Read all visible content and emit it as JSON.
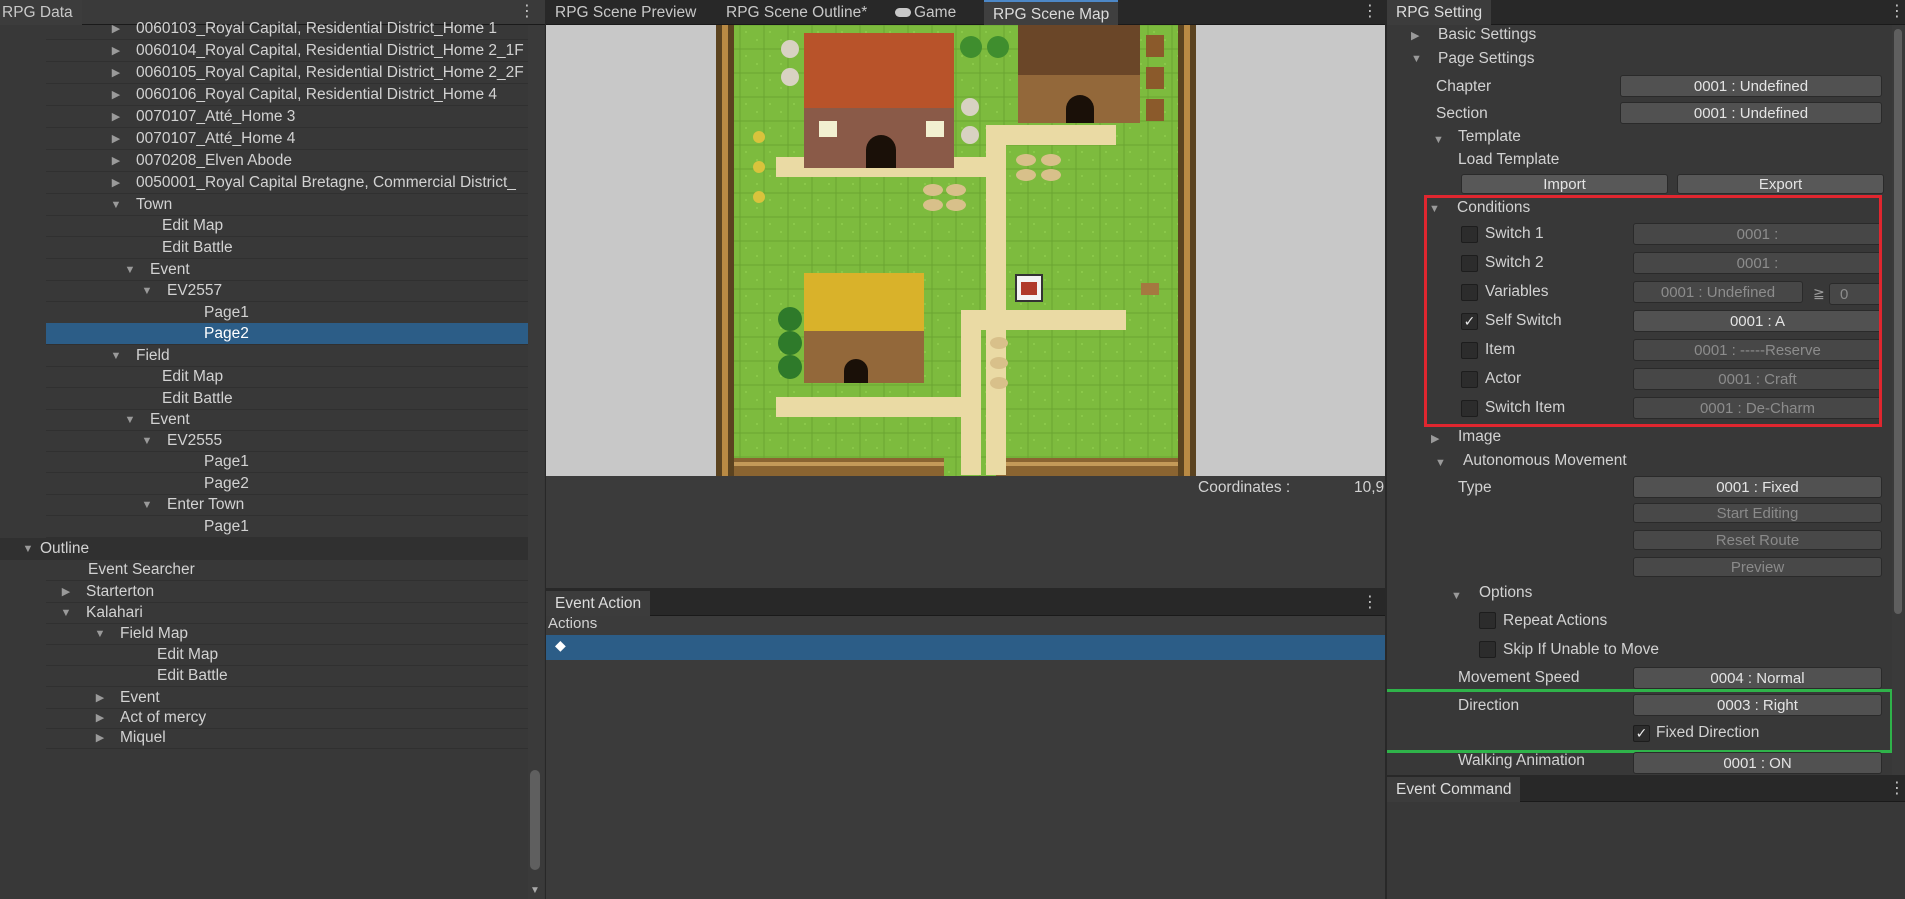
{
  "left": {
    "tab": "RPG Data",
    "rows": [
      {
        "label": "0060103_Royal Capital, Residential District_Home 1",
        "arrow": "right"
      },
      {
        "label": "0060104_Royal Capital, Residential District_Home 2_1F",
        "arrow": "right"
      },
      {
        "label": "0060105_Royal Capital, Residential District_Home 2_2F",
        "arrow": "right"
      },
      {
        "label": "0060106_Royal Capital, Residential District_Home 4",
        "arrow": "right"
      },
      {
        "label": "0070107_Atté_Home 3",
        "arrow": "right"
      },
      {
        "label": "0070107_Atté_Home 4",
        "arrow": "right"
      },
      {
        "label": "0070208_Elven Abode",
        "arrow": "right"
      },
      {
        "label": "0050001_Royal Capital Bretagne, Commercial District_",
        "arrow": "right"
      },
      {
        "label": "Town",
        "arrow": "down"
      },
      {
        "label": "Edit Map",
        "arrow": ""
      },
      {
        "label": "Edit Battle",
        "arrow": ""
      },
      {
        "label": "Event",
        "arrow": "down"
      },
      {
        "label": "EV2557",
        "arrow": "down"
      },
      {
        "label": "Page1",
        "arrow": ""
      },
      {
        "label": "Page2",
        "arrow": ""
      },
      {
        "label": "Field",
        "arrow": "down"
      },
      {
        "label": "Edit Map",
        "arrow": ""
      },
      {
        "label": "Edit Battle",
        "arrow": ""
      },
      {
        "label": "Event",
        "arrow": "down"
      },
      {
        "label": "EV2555",
        "arrow": "down"
      },
      {
        "label": "Page1",
        "arrow": ""
      },
      {
        "label": "Page2",
        "arrow": ""
      },
      {
        "label": "Enter Town",
        "arrow": "down"
      },
      {
        "label": "Page1",
        "arrow": ""
      },
      {
        "label": "Outline",
        "arrow": "down"
      },
      {
        "label": "Event Searcher",
        "arrow": ""
      },
      {
        "label": "Starterton",
        "arrow": "right"
      },
      {
        "label": "Kalahari",
        "arrow": "down"
      },
      {
        "label": "Field Map",
        "arrow": "down"
      },
      {
        "label": "Edit Map",
        "arrow": ""
      },
      {
        "label": "Edit Battle",
        "arrow": ""
      },
      {
        "label": "Event",
        "arrow": "right"
      },
      {
        "label": "Act of mercy",
        "arrow": "right"
      },
      {
        "label": "Miquel",
        "arrow": "right"
      }
    ]
  },
  "center": {
    "tabs": [
      "RPG Scene Preview",
      "RPG Scene Outline*",
      "Game",
      "RPG Scene Map"
    ],
    "coordinates_label": "Coordinates :",
    "coordinates_value": "10,9",
    "event_action_tab": "Event Action",
    "actions_header": "Actions",
    "action_marker": "◆"
  },
  "right": {
    "tab": "RPG Setting",
    "basic_settings": "Basic Settings",
    "page_settings": "Page Settings",
    "chapter_label": "Chapter",
    "chapter_value": "0001 : Undefined",
    "section_label": "Section",
    "section_value": "0001 : Undefined",
    "template_label": "Template",
    "load_template": "Load Template",
    "import": "Import",
    "export": "Export",
    "conditions": "Conditions",
    "cond": [
      {
        "label": "Switch 1",
        "value": "0001 :",
        "checked": false
      },
      {
        "label": "Switch 2",
        "value": "0001 :",
        "checked": false
      },
      {
        "label": "Variables",
        "value": "0001 : Undefined",
        "checked": false
      },
      {
        "label": "Self Switch",
        "value": "0001 : A",
        "checked": true
      },
      {
        "label": "Item",
        "value": "0001 : -----Reserve",
        "checked": false
      },
      {
        "label": "Actor",
        "value": "0001 : Craft",
        "checked": false
      },
      {
        "label": "Switch Item",
        "value": "0001 : De-Charm",
        "checked": false
      }
    ],
    "var_op": "≧",
    "var_value": "0",
    "image": "Image",
    "auto_move": "Autonomous Movement",
    "type_label": "Type",
    "type_value": "0001 : Fixed",
    "start_editing": "Start Editing",
    "reset_route": "Reset Route",
    "preview": "Preview",
    "options": "Options",
    "repeat_actions": "Repeat Actions",
    "skip_unable": "Skip If Unable to Move",
    "move_speed_label": "Movement Speed",
    "move_speed_value": "0004 : Normal",
    "direction_label": "Direction",
    "direction_value": "0003 : Right",
    "fixed_direction": "Fixed Direction",
    "walking_label": "Walking Animation",
    "walking_value": "0001 : ON",
    "event_command_tab": "Event Command",
    "highlight_red": "#e0262f",
    "highlight_green": "#2fb34a"
  }
}
